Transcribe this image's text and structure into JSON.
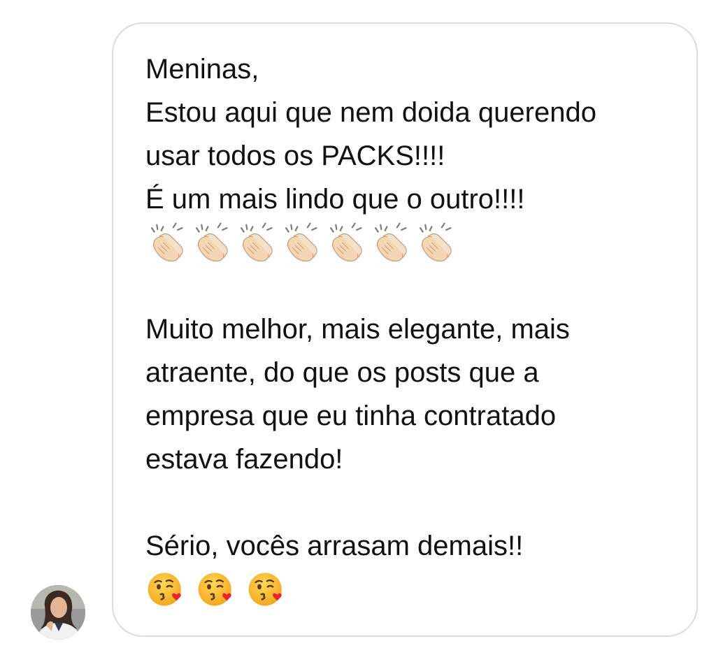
{
  "message": {
    "line1": "Meninas,",
    "line2": "Estou aqui que nem doida querendo",
    "line3": "usar todos os PACKS!!!!",
    "line4": "É um mais lindo que o outro!!!!",
    "line5": "Muito melhor, mais elegante, mais",
    "line6": "atraente, do que os posts que a",
    "line7": "empresa que eu tinha contratado",
    "line8": "estava fazendo!",
    "line9": "Sério, vocês arrasam demais!!",
    "clap_emojis": [
      "clapping-hands-icon",
      "clapping-hands-icon",
      "clapping-hands-icon",
      "clapping-hands-icon",
      "clapping-hands-icon",
      "clapping-hands-icon",
      "clapping-hands-icon"
    ],
    "kiss_emojis": [
      "face-blowing-kiss-icon",
      "face-blowing-kiss-icon",
      "face-blowing-kiss-icon"
    ]
  },
  "colors": {
    "bubble_border": "#dcdcdc",
    "text": "#111111",
    "background": "#ffffff"
  }
}
